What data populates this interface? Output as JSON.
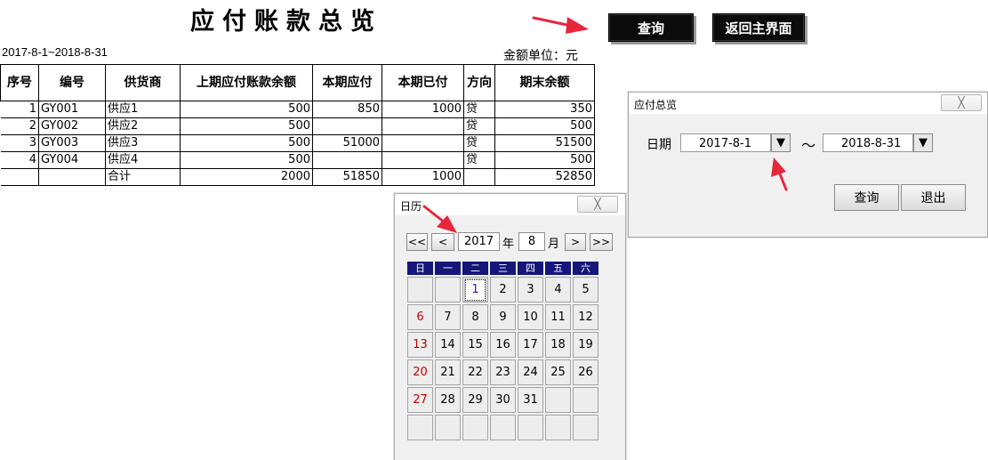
{
  "sheet": {
    "title": "应付账款总览",
    "query_button": "查询",
    "home_button": "返回主界面",
    "date_range": "2017-8-1~2018-8-31",
    "unit_label": "金额单位：元"
  },
  "table": {
    "headers": [
      "序号",
      "编号",
      "供货商",
      "上期应付账款余额",
      "本期应付",
      "本期已付",
      "方向",
      "期末余额"
    ],
    "rows": [
      [
        "1",
        "GY001",
        "供应1",
        "500",
        "850",
        "1000",
        "贷",
        "350"
      ],
      [
        "2",
        "GY002",
        "供应2",
        "500",
        "",
        "",
        "贷",
        "500"
      ],
      [
        "3",
        "GY003",
        "供应3",
        "500",
        "51000",
        "",
        "贷",
        "51500"
      ],
      [
        "4",
        "GY004",
        "供应4",
        "500",
        "",
        "",
        "贷",
        "500"
      ]
    ],
    "total": [
      "",
      "",
      "合计",
      "2000",
      "51850",
      "1000",
      "",
      "52850"
    ]
  },
  "pay_dialog": {
    "title": "应付总览",
    "close": "╳",
    "date_label": "日期",
    "start_date": "2017-8-1",
    "end_date": "2018-8-31",
    "tilde": "～",
    "query_button": "查询",
    "exit_button": "退出",
    "dropdown_glyph": "▼"
  },
  "calendar": {
    "title": "日历",
    "close": "╳",
    "year": "2017",
    "year_unit": "年",
    "month": "8",
    "month_unit": "月",
    "nav": [
      "<<",
      "<",
      ">",
      ">>"
    ],
    "weekdays": [
      "日",
      "一",
      "二",
      "三",
      "四",
      "五",
      "六"
    ],
    "weeks": [
      [
        "",
        "",
        "1",
        "2",
        "3",
        "4",
        "5"
      ],
      [
        "6",
        "7",
        "8",
        "9",
        "10",
        "11",
        "12"
      ],
      [
        "13",
        "14",
        "15",
        "16",
        "17",
        "18",
        "19"
      ],
      [
        "20",
        "21",
        "22",
        "23",
        "24",
        "25",
        "26"
      ],
      [
        "27",
        "28",
        "29",
        "30",
        "31",
        "",
        ""
      ],
      [
        "",
        "",
        "",
        "",
        "",
        "",
        ""
      ]
    ],
    "selected_day": "1"
  },
  "colors": {
    "annotation_arrow": "#e8263a",
    "weekday_header": "#15157a",
    "sunday_text": "#c20000"
  }
}
